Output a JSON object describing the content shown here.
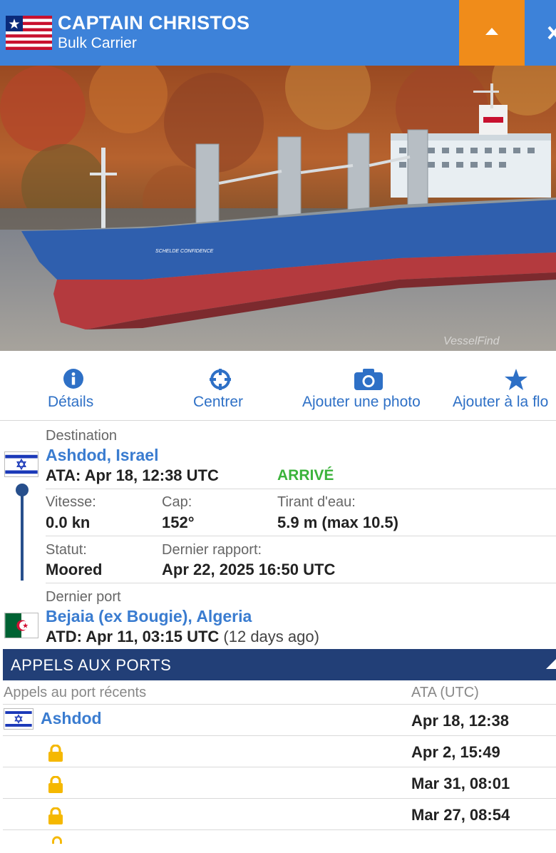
{
  "header": {
    "vessel_name": "CAPTAIN CHRISTOS",
    "vessel_type": "Bulk Carrier",
    "flag_icon": "liberia-flag-icon",
    "colors": {
      "header_bg": "#3d82d9",
      "collapse_bg": "#f08c1a"
    }
  },
  "photo": {
    "hull_name": "SCHELDE CONFIDENCE",
    "watermark": "VesselFind"
  },
  "actions": [
    {
      "label": "Détails",
      "icon": "info-icon"
    },
    {
      "label": "Centrer",
      "icon": "crosshair-icon"
    },
    {
      "label": "Ajouter une photo",
      "icon": "camera-icon"
    },
    {
      "label": "Ajouter à la flo",
      "icon": "star-icon"
    }
  ],
  "destination": {
    "label": "Destination",
    "port": "Ashdod, Israel",
    "ata": "ATA: Apr 18, 12:38 UTC",
    "status": "ARRIVÉ",
    "flag_icon": "israel-flag-icon"
  },
  "metrics": {
    "speed_label": "Vitesse:",
    "speed_value": "0.0 kn",
    "heading_label": "Cap:",
    "heading_value": "152°",
    "draught_label": "Tirant d'eau:",
    "draught_value": "5.9 m (max 10.5)",
    "status_label": "Statut:",
    "status_value": "Moored",
    "report_label": "Dernier rapport:",
    "report_value": "Apr 22, 2025 16:50 UTC"
  },
  "last_port": {
    "label": "Dernier port",
    "port": "Bejaia (ex Bougie), Algeria",
    "atd": "ATD: Apr 11, 03:15 UTC",
    "relative": "(12 days ago)",
    "flag_icon": "algeria-flag-icon"
  },
  "port_calls": {
    "section_title": "APPELS AUX PORTS",
    "col_recent": "Appels au port récents",
    "col_ata": "ATA (UTC)",
    "rows": [
      {
        "port": "Ashdod",
        "date": "Apr 18, 12:38",
        "locked": false
      },
      {
        "port": "",
        "date": "Apr 2, 15:49",
        "locked": true
      },
      {
        "port": "",
        "date": "Mar 31, 08:01",
        "locked": true
      },
      {
        "port": "",
        "date": "Mar 27, 08:54",
        "locked": true
      }
    ]
  }
}
